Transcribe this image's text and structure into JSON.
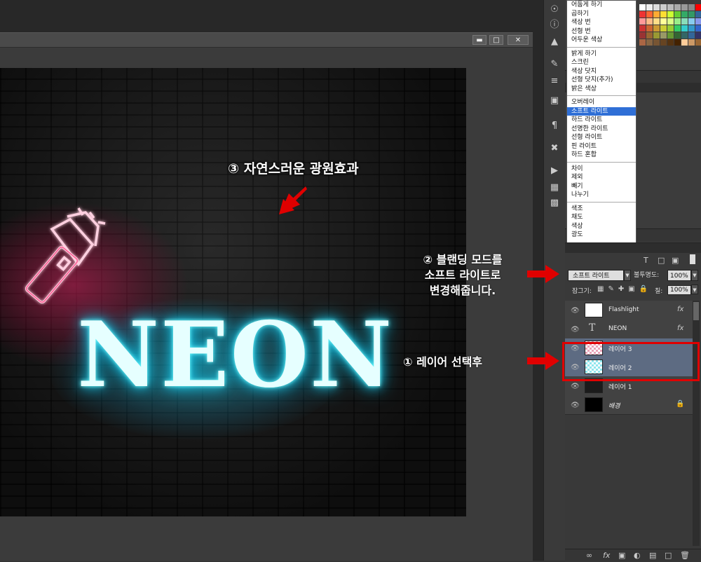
{
  "blend_menu": {
    "groups": [
      [
        "어둡게 하기",
        "곱하기",
        "색상 번",
        "선형 번",
        "어두운 색상"
      ],
      [
        "밝게 하기",
        "스크린",
        "색상 닷지",
        "선형 닷지(추가)",
        "밝은 색상"
      ],
      [
        "오버레이",
        "소프트 라이트",
        "하드 라이트",
        "선명한 라이트",
        "선형 라이트",
        "핀 라이트",
        "하드 혼합"
      ],
      [
        "차이",
        "제외",
        "빼기",
        "나누기"
      ],
      [
        "색조",
        "채도",
        "색상",
        "광도"
      ]
    ],
    "selected": "소프트 라이트"
  },
  "layers_panel": {
    "blend_mode_value": "소프트 라이트",
    "opacity_label": "불투명도:",
    "opacity_value": "100%",
    "lock_label": "잠그기:",
    "fill_label": "칠:",
    "fill_value": "100%",
    "layers": [
      {
        "name": "Flashlight",
        "fx": "fx",
        "selected": false
      },
      {
        "name": "NEON",
        "fx": "fx",
        "selected": false
      },
      {
        "name": "레이어 3",
        "fx": "",
        "selected": true
      },
      {
        "name": "레이어 2",
        "fx": "",
        "selected": true
      },
      {
        "name": "레이어 1",
        "fx": "",
        "selected": false
      },
      {
        "name": "배경",
        "fx": "",
        "selected": false
      }
    ]
  },
  "canvas": {
    "neon_text": "NEON"
  },
  "annotations": {
    "step3": "③ 자연스러운 광원효과",
    "step2_line1": "② 블랜딩 모드를",
    "step2_line2": "소프트 라이트로",
    "step2_line3": "변경해줍니다.",
    "step1": "① 레이어 선택후"
  },
  "colors": {
    "selection_highlight": "#2f6fd6",
    "annotation_arrow": "#e00000",
    "selected_layer": "#5d6b82",
    "neon_cyan": "#2ce",
    "neon_pink": "#d21e5a"
  }
}
